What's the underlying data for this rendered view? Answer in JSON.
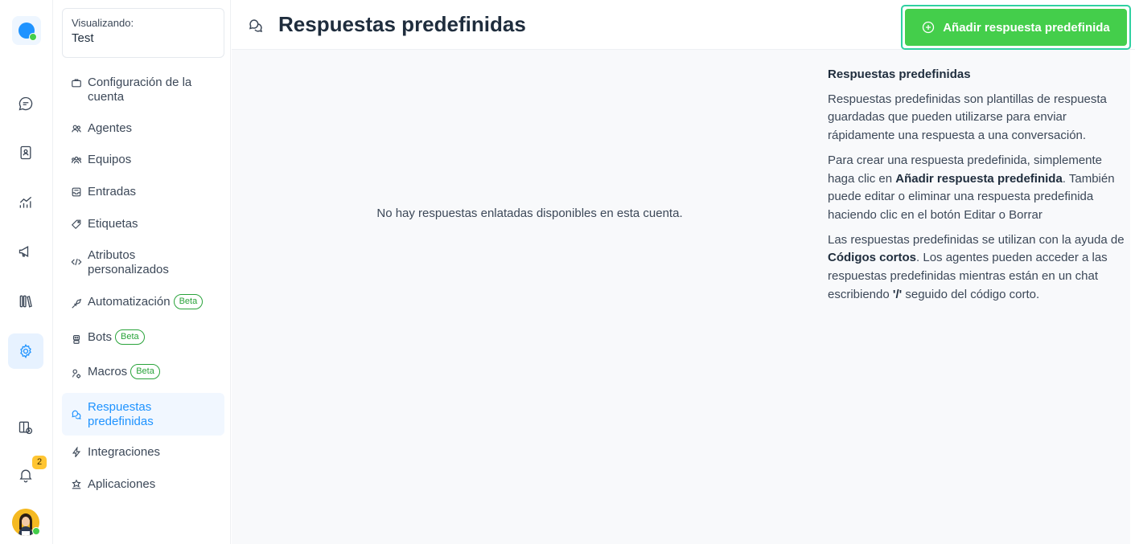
{
  "rail": {
    "notification_count": "2"
  },
  "sidebar": {
    "account_label": "Visualizando:",
    "account_value": "Test",
    "beta_label": "Beta",
    "items": [
      {
        "label": "Configuración de la cuenta"
      },
      {
        "label": "Agentes"
      },
      {
        "label": "Equipos"
      },
      {
        "label": "Entradas"
      },
      {
        "label": "Etiquetas"
      },
      {
        "label": "Atributos personalizados"
      },
      {
        "label": "Automatización"
      },
      {
        "label": "Bots"
      },
      {
        "label": "Macros"
      },
      {
        "label": "Respuestas predefinidas"
      },
      {
        "label": "Integraciones"
      },
      {
        "label": "Aplicaciones"
      }
    ]
  },
  "header": {
    "title": "Respuestas predefinidas",
    "add_button": "Añadir respuesta predefinida"
  },
  "main": {
    "empty_message": "No hay respuestas enlatadas disponibles en esta cuenta."
  },
  "help": {
    "title": "Respuestas predefinidas",
    "p1": "Respuestas predefinidas son plantillas de respuesta guardadas que pueden utilizarse para enviar rápidamente una respuesta a una conversación.",
    "p2_before": "Para crear una respuesta predefinida, simplemente haga clic en ",
    "p2_bold": "Añadir respuesta predefinida",
    "p2_after": ". También puede editar o eliminar una respuesta predefinida haciendo clic en el botón Editar o Borrar",
    "p3_before": "Las respuestas predefinidas se utilizan con la ayuda de ",
    "p3_bold": "Códigos cortos",
    "p3_middle": ". Los agentes pueden acceder a las respuestas predefinidas mientras están en un chat escribiendo ",
    "p3_bold2": "'/'",
    "p3_after": " seguido del código corto."
  },
  "colors": {
    "accent": "#1f93ff",
    "success": "#44ce4b",
    "badge": "#ffc532"
  }
}
